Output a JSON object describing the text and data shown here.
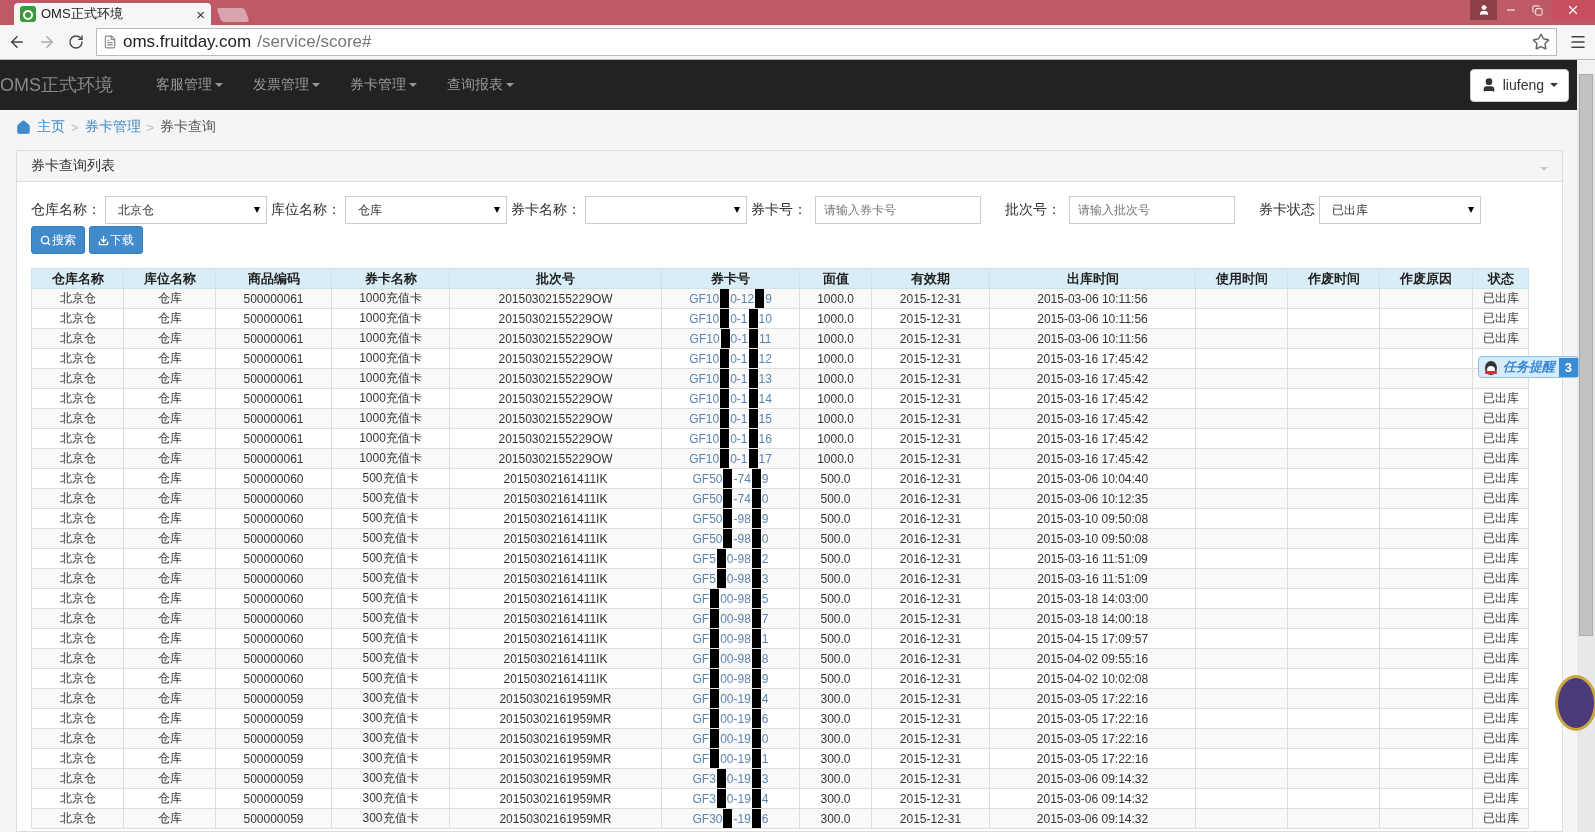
{
  "browser": {
    "tab_title": "OMS正式环境",
    "tab_close": "×",
    "url_host": "oms.fruitday.com",
    "url_path": "/service/score#"
  },
  "navbar": {
    "brand": "OMS正式环境",
    "menus": [
      "客服管理",
      "发票管理",
      "券卡管理",
      "查询报表"
    ],
    "user": "liufeng"
  },
  "breadcrumb": [
    {
      "label": "主页"
    },
    {
      "sep": ">",
      "label": "券卡管理"
    },
    {
      "sep": ">",
      "label": "券卡查询"
    }
  ],
  "panel": {
    "title": "券卡查询列表",
    "filters": [
      {
        "label": "仓库名称：",
        "kind": "select",
        "value": "北京仓"
      },
      {
        "label": "库位名称：",
        "kind": "select",
        "value": "仓库"
      },
      {
        "label": "券卡名称：",
        "kind": "select"
      },
      {
        "label": "券卡号：",
        "kind": "input",
        "placeholder": "请输入券卡号"
      },
      {
        "label": "批次号：",
        "kind": "input",
        "placeholder": "请输入批次号"
      },
      {
        "label": "券卡状态",
        "kind": "select",
        "value": "已出库"
      }
    ],
    "buttons": [
      {
        "label": "搜索",
        "kind": "search"
      },
      {
        "label": "下载",
        "kind": "download"
      }
    ]
  },
  "table": {
    "columns": [
      "仓库名称",
      "库位名称",
      "商品编码",
      "券卡名称",
      "批次号",
      "券卡号",
      "面值",
      "有效期",
      "出库时间",
      "使用时间",
      "作废时间",
      "作废原因",
      "状态"
    ],
    "rows": [
      {
        "cells": [
          "北京仓",
          "仓库",
          "500000061",
          "1000充值卡",
          "20150302155229OW"
        ],
        "card_no": [
          "GF10",
          "0-12",
          "9"
        ],
        "face_value": "1000.0",
        "expiry": "2015-12-31",
        "out_time": "2015-03-06 10:11:56",
        "status": "已出库"
      },
      {
        "cells": [
          "北京仓",
          "仓库",
          "500000061",
          "1000充值卡",
          "20150302155229OW"
        ],
        "card_no": [
          "GF10",
          "0-1",
          "10"
        ],
        "face_value": "1000.0",
        "expiry": "2015-12-31",
        "out_time": "2015-03-06 10:11:56",
        "status": "已出库"
      },
      {
        "cells": [
          "北京仓",
          "仓库",
          "500000061",
          "1000充值卡",
          "20150302155229OW"
        ],
        "card_no": [
          "GF10",
          "0-1",
          "11"
        ],
        "face_value": "1000.0",
        "expiry": "2015-12-31",
        "out_time": "2015-03-06 10:11:56",
        "status": "已出库"
      },
      {
        "cells": [
          "北京仓",
          "仓库",
          "500000061",
          "1000充值卡",
          "20150302155229OW"
        ],
        "card_no": [
          "GF10",
          "0-1",
          "12"
        ],
        "face_value": "1000.0",
        "expiry": "2015-12-31",
        "out_time": "2015-03-16 17:45:42"
      },
      {
        "cells": [
          "北京仓",
          "仓库",
          "500000061",
          "1000充值卡",
          "20150302155229OW"
        ],
        "card_no": [
          "GF10",
          "0-1",
          "13"
        ],
        "face_value": "1000.0",
        "expiry": "2015-12-31",
        "out_time": "2015-03-16 17:45:42"
      },
      {
        "cells": [
          "北京仓",
          "仓库",
          "500000061",
          "1000充值卡",
          "20150302155229OW"
        ],
        "card_no": [
          "GF10",
          "0-1",
          "14"
        ],
        "face_value": "1000.0",
        "expiry": "2015-12-31",
        "out_time": "2015-03-16 17:45:42",
        "status": "已出库"
      },
      {
        "cells": [
          "北京仓",
          "仓库",
          "500000061",
          "1000充值卡",
          "20150302155229OW"
        ],
        "card_no": [
          "GF10",
          "0-1",
          "15"
        ],
        "face_value": "1000.0",
        "expiry": "2015-12-31",
        "out_time": "2015-03-16 17:45:42",
        "status": "已出库"
      },
      {
        "cells": [
          "北京仓",
          "仓库",
          "500000061",
          "1000充值卡",
          "20150302155229OW"
        ],
        "card_no": [
          "GF10",
          "0-1",
          "16"
        ],
        "face_value": "1000.0",
        "expiry": "2015-12-31",
        "out_time": "2015-03-16 17:45:42",
        "status": "已出库"
      },
      {
        "cells": [
          "北京仓",
          "仓库",
          "500000061",
          "1000充值卡",
          "20150302155229OW"
        ],
        "card_no": [
          "GF10",
          "0-1",
          "17"
        ],
        "face_value": "1000.0",
        "expiry": "2015-12-31",
        "out_time": "2015-03-16 17:45:42",
        "status": "已出库"
      },
      {
        "cells": [
          "北京仓",
          "仓库",
          "500000060",
          "500充值卡",
          "20150302161411IK"
        ],
        "card_no": [
          "GF50",
          "-74",
          "9"
        ],
        "face_value": "500.0",
        "expiry": "2016-12-31",
        "out_time": "2015-03-06 10:04:40",
        "status": "已出库"
      },
      {
        "cells": [
          "北京仓",
          "仓库",
          "500000060",
          "500充值卡",
          "20150302161411IK"
        ],
        "card_no": [
          "GF50",
          "-74",
          "0"
        ],
        "face_value": "500.0",
        "expiry": "2016-12-31",
        "out_time": "2015-03-06 10:12:35",
        "status": "已出库"
      },
      {
        "cells": [
          "北京仓",
          "仓库",
          "500000060",
          "500充值卡",
          "20150302161411IK"
        ],
        "card_no": [
          "GF50",
          "-98",
          "9"
        ],
        "face_value": "500.0",
        "expiry": "2016-12-31",
        "out_time": "2015-03-10 09:50:08",
        "status": "已出库"
      },
      {
        "cells": [
          "北京仓",
          "仓库",
          "500000060",
          "500充值卡",
          "20150302161411IK"
        ],
        "card_no": [
          "GF50",
          "-98",
          "0"
        ],
        "face_value": "500.0",
        "expiry": "2016-12-31",
        "out_time": "2015-03-10 09:50:08",
        "status": "已出库"
      },
      {
        "cells": [
          "北京仓",
          "仓库",
          "500000060",
          "500充值卡",
          "20150302161411IK"
        ],
        "card_no": [
          "GF5",
          "0-98",
          "2"
        ],
        "face_value": "500.0",
        "expiry": "2016-12-31",
        "out_time": "2015-03-16 11:51:09",
        "status": "已出库"
      },
      {
        "cells": [
          "北京仓",
          "仓库",
          "500000060",
          "500充值卡",
          "20150302161411IK"
        ],
        "card_no": [
          "GF5",
          "0-98",
          "3"
        ],
        "face_value": "500.0",
        "expiry": "2016-12-31",
        "out_time": "2015-03-16 11:51:09",
        "status": "已出库"
      },
      {
        "cells": [
          "北京仓",
          "仓库",
          "500000060",
          "500充值卡",
          "20150302161411IK"
        ],
        "card_no": [
          "GF",
          "00-98",
          "5"
        ],
        "face_value": "500.0",
        "expiry": "2016-12-31",
        "out_time": "2015-03-18 14:03:00",
        "status": "已出库"
      },
      {
        "cells": [
          "北京仓",
          "仓库",
          "500000060",
          "500充值卡",
          "20150302161411IK"
        ],
        "card_no": [
          "GF",
          "00-98",
          "7"
        ],
        "face_value": "500.0",
        "expiry": "2015-12-31",
        "out_time": "2015-03-18 14:00:18",
        "status": "已出库"
      },
      {
        "cells": [
          "北京仓",
          "仓库",
          "500000060",
          "500充值卡",
          "20150302161411IK"
        ],
        "card_no": [
          "GF",
          "00-98",
          "1"
        ],
        "face_value": "500.0",
        "expiry": "2016-12-31",
        "out_time": "2015-04-15 17:09:57",
        "status": "已出库"
      },
      {
        "cells": [
          "北京仓",
          "仓库",
          "500000060",
          "500充值卡",
          "20150302161411IK"
        ],
        "card_no": [
          "GF",
          "00-98",
          "8"
        ],
        "face_value": "500.0",
        "expiry": "2016-12-31",
        "out_time": "2015-04-02 09:55:16",
        "status": "已出库"
      },
      {
        "cells": [
          "北京仓",
          "仓库",
          "500000060",
          "500充值卡",
          "20150302161411IK"
        ],
        "card_no": [
          "GF",
          "00-98",
          "9"
        ],
        "face_value": "500.0",
        "expiry": "2016-12-31",
        "out_time": "2015-04-02 10:02:08",
        "status": "已出库"
      },
      {
        "cells": [
          "北京仓",
          "仓库",
          "500000059",
          "300充值卡",
          "20150302161959MR"
        ],
        "card_no": [
          "GF",
          "00-19",
          "4"
        ],
        "face_value": "300.0",
        "expiry": "2015-12-31",
        "out_time": "2015-03-05 17:22:16",
        "status": "已出库"
      },
      {
        "cells": [
          "北京仓",
          "仓库",
          "500000059",
          "300充值卡",
          "20150302161959MR"
        ],
        "card_no": [
          "GF",
          "00-19",
          "6"
        ],
        "face_value": "300.0",
        "expiry": "2015-12-31",
        "out_time": "2015-03-05 17:22:16",
        "status": "已出库"
      },
      {
        "cells": [
          "北京仓",
          "仓库",
          "500000059",
          "300充值卡",
          "20150302161959MR"
        ],
        "card_no": [
          "GF",
          "00-19",
          "0"
        ],
        "face_value": "300.0",
        "expiry": "2015-12-31",
        "out_time": "2015-03-05 17:22:16",
        "status": "已出库"
      },
      {
        "cells": [
          "北京仓",
          "仓库",
          "500000059",
          "300充值卡",
          "20150302161959MR"
        ],
        "card_no": [
          "GF",
          "00-19",
          "1"
        ],
        "face_value": "300.0",
        "expiry": "2015-12-31",
        "out_time": "2015-03-05 17:22:16",
        "status": "已出库"
      },
      {
        "cells": [
          "北京仓",
          "仓库",
          "500000059",
          "300充值卡",
          "20150302161959MR"
        ],
        "card_no": [
          "GF3",
          "0-19",
          "3"
        ],
        "face_value": "300.0",
        "expiry": "2015-12-31",
        "out_time": "2015-03-06 09:14:32",
        "status": "已出库"
      },
      {
        "cells": [
          "北京仓",
          "仓库",
          "500000059",
          "300充值卡",
          "20150302161959MR"
        ],
        "card_no": [
          "GF3",
          "0-19",
          "4"
        ],
        "face_value": "300.0",
        "expiry": "2015-12-31",
        "out_time": "2015-03-06 09:14:32",
        "status": "已出库"
      },
      {
        "cells": [
          "北京仓",
          "仓库",
          "500000059",
          "300充值卡",
          "20150302161959MR"
        ],
        "card_no": [
          "GF30",
          "-19",
          "6"
        ],
        "face_value": "300.0",
        "expiry": "2015-12-31",
        "out_time": "2015-03-06 09:14:32",
        "status": "已出库"
      }
    ]
  },
  "reminder": {
    "label": "任务提醒",
    "count": "3"
  }
}
